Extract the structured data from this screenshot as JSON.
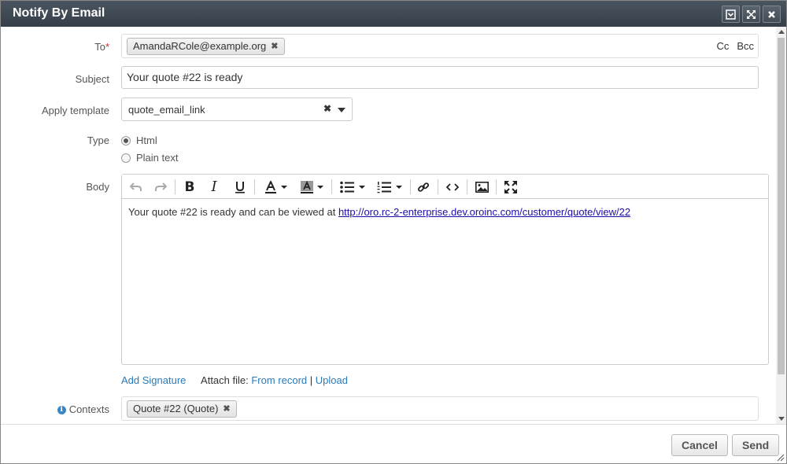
{
  "dialog": {
    "title": "Notify By Email"
  },
  "form": {
    "to_label": "To",
    "to_required": "*",
    "to_recipients": [
      "AmandaRCole@example.org"
    ],
    "cc_label": "Cc",
    "bcc_label": "Bcc",
    "subject_label": "Subject",
    "subject_value": "Your quote #22 is ready",
    "template_label": "Apply template",
    "template_value": "quote_email_link",
    "type_label": "Type",
    "type_options": [
      {
        "label": "Html",
        "checked": true
      },
      {
        "label": "Plain text",
        "checked": false
      }
    ],
    "body_label": "Body",
    "body_text": "Your quote #22 is ready and can be viewed at ",
    "body_link": "http://oro.rc-2-enterprise.dev.oroinc.com/customer/quote/view/22",
    "add_signature": "Add Signature",
    "attach_label": "Attach file:",
    "from_record": "From record",
    "attach_sep": "|",
    "upload": "Upload",
    "contexts_label": "Contexts",
    "contexts": [
      "Quote #22 (Quote)"
    ]
  },
  "footer": {
    "cancel_label": "Cancel",
    "send_label": "Send"
  },
  "colors": {
    "link": "#2a7ab8",
    "required": "#c9302c",
    "titlebar": "#3d4650"
  }
}
